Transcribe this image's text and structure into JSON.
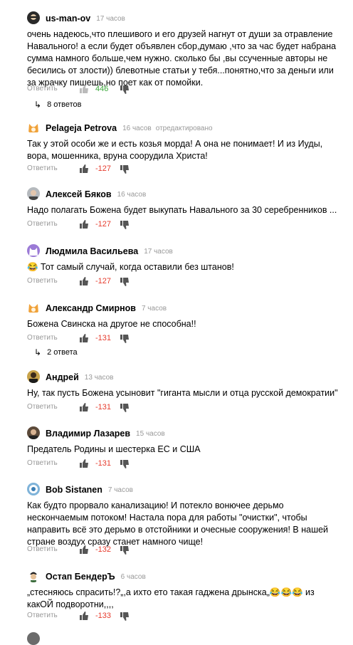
{
  "reply_label": "Ответить",
  "comments": [
    {
      "name": "us-man-ov",
      "time": "17 часов",
      "edited": "",
      "text": "очень надеюсь,что плешивого и его друзей нагнут от души за отравление Навального! а если будет объявлен сбор,думаю ,что за час будет набрана сумма намного больше,чем нужно. сколько бы ,вы ссученные авторы не бесились от злости)) блевотные статьи у тебя...понятно,что за деньги или за жрачку пишешь,но поет как от помойки.",
      "score": "446",
      "replies": "8 ответов"
    },
    {
      "name": "Pelageja Petrova",
      "time": "16 часов",
      "edited": "отредактировано",
      "text": "Так у этой особи же и есть козья морда! А она не понимает! И из Иуды, вора, мошенника, вруна соорудила Христа!",
      "score": "-127",
      "replies": ""
    },
    {
      "name": "Алексей Бяков",
      "time": "16 часов",
      "edited": "",
      "text": "Надо полагать Божена будет выкупать Навального за 30 серебренников ...",
      "score": "-127",
      "replies": ""
    },
    {
      "name": "Людмила Васильева",
      "time": "17 часов",
      "edited": "",
      "text": "😂 Тот самый случай, когда оставили без штанов!",
      "score": "-127",
      "replies": ""
    },
    {
      "name": "Александр Смирнов",
      "time": "7 часов",
      "edited": "",
      "text": "Божена Свинска на другое не способна!!",
      "score": "-131",
      "replies": "2 ответа"
    },
    {
      "name": "Андрей",
      "time": "13 часов",
      "edited": "",
      "text": "Ну, так пусть Божена усыновит \"гиганта мысли и отца русской демократии\"",
      "score": "-131",
      "replies": ""
    },
    {
      "name": "Владимир Лазарев",
      "time": "15 часов",
      "edited": "",
      "text": "Предатель Родины и шестерка ЕС и США",
      "score": "-131",
      "replies": ""
    },
    {
      "name": "Bob Sistanen",
      "time": "7 часов",
      "edited": "",
      "text": "Как будто прорвало канализацию! И потекло вонючее дерьмо нескончаемым потоком! Настала пора для работы \"очистки\", чтобы направить всё это дерьмо в отстойники и очесные сооружения! В нашей стране воздух сразу станет намного чище!",
      "score": "-132",
      "replies": ""
    },
    {
      "name": "Остап БендерЪ",
      "time": "6 часов",
      "edited": "",
      "text": "„стесняюсь спрасить!?„,а ихто ето такая гаджена дрынска„😂😂😂 из какОЙ подворотни,,,,",
      "score": "-133",
      "replies": ""
    }
  ]
}
